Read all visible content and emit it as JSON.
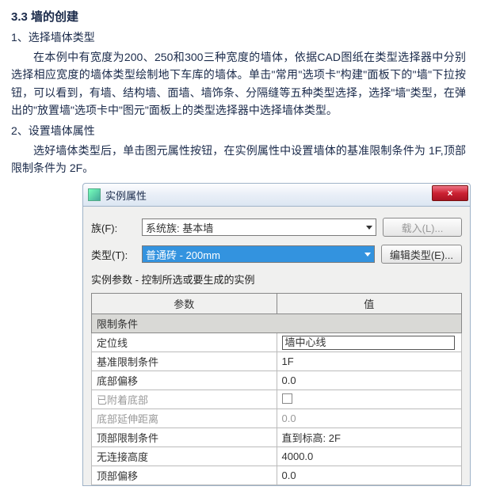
{
  "doc": {
    "section_title": "3.3  墙的创建",
    "item1": "1、选择墙体类型",
    "para1": "在本例中有宽度为200、250和300三种宽度的墙体，依据CAD图纸在类型选择器中分别选择相应宽度的墙体类型绘制地下车库的墙体。单击\"常用\"选项卡\"构建\"面板下的\"墙\"下拉按钮，可以看到，有墙、结构墙、面墙、墙饰条、分隔缝等五种类型选择，选择\"墙\"类型，在弹出的\"放置墙\"选项卡中\"图元\"面板上的类型选择器中选择墙体类型。",
    "item2": "2、设置墙体属性",
    "para2": "选好墙体类型后，单击图元属性按钮，在实例属性中设置墙体的基准限制条件为 1F,顶部限制条件为 2F。"
  },
  "dialog": {
    "title": "实例属性",
    "close": "×",
    "family_label": "族(F):",
    "family_value": "系统族: 基本墙",
    "load_btn": "载入(L)...",
    "type_label": "类型(T):",
    "type_value": "普通砖 - 200mm",
    "edit_type_btn": "编辑类型(E)...",
    "params_caption": "实例参数 - 控制所选或要生成的实例",
    "col_param": "参数",
    "col_value": "值",
    "rows": {
      "group1": "限制条件",
      "r1_p": "定位线",
      "r1_v": "墙中心线",
      "r2_p": "基准限制条件",
      "r2_v": "1F",
      "r3_p": "底部偏移",
      "r3_v": "0.0",
      "r4_p": "已附着底部",
      "r4_v": "",
      "r5_p": "底部延伸距离",
      "r5_v": "0.0",
      "r6_p": "顶部限制条件",
      "r6_v": "直到标高: 2F",
      "r7_p": "无连接高度",
      "r7_v": "4000.0",
      "r8_p": "顶部偏移",
      "r8_v": "0.0"
    }
  }
}
